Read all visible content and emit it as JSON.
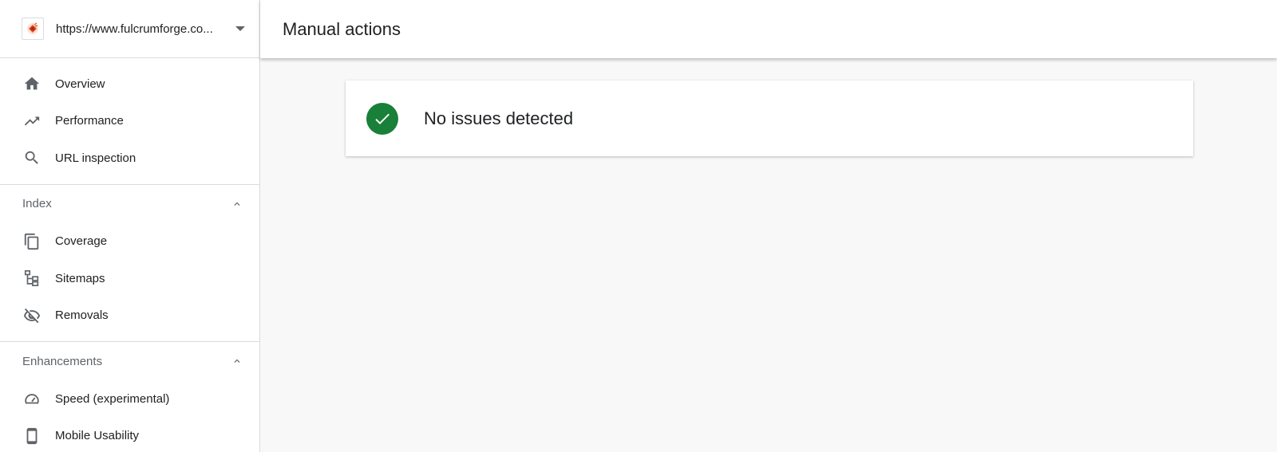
{
  "property": {
    "url": "https://www.fulcrumforge.co...",
    "favicon_icon": "site-favicon"
  },
  "nav": {
    "primary": [
      {
        "label": "Overview",
        "icon": "home-icon"
      },
      {
        "label": "Performance",
        "icon": "trending-up-icon"
      },
      {
        "label": "URL inspection",
        "icon": "search-icon"
      }
    ],
    "index": {
      "title": "Index",
      "items": [
        {
          "label": "Coverage",
          "icon": "copy-pages-icon"
        },
        {
          "label": "Sitemaps",
          "icon": "sitemap-icon"
        },
        {
          "label": "Removals",
          "icon": "eye-off-icon"
        }
      ]
    },
    "enhancements": {
      "title": "Enhancements",
      "items": [
        {
          "label": "Speed (experimental)",
          "icon": "speedometer-icon"
        },
        {
          "label": "Mobile Usability",
          "icon": "phone-icon"
        }
      ]
    }
  },
  "header": {
    "title": "Manual actions"
  },
  "status": {
    "message": "No issues detected",
    "icon": "check-circle-icon",
    "color": "#188038"
  },
  "colors": {
    "icon_gray": "#5f6368",
    "divider": "#dadce0",
    "background": "#f8f8f8"
  }
}
